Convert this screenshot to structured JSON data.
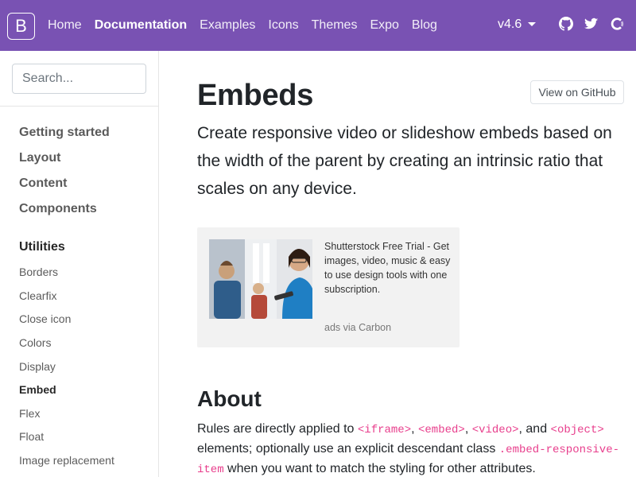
{
  "colors": {
    "navbar": "#7952b3",
    "code": "#e83e8c"
  },
  "navbar": {
    "brand": "B",
    "links": [
      {
        "label": "Home"
      },
      {
        "label": "Documentation"
      },
      {
        "label": "Examples"
      },
      {
        "label": "Icons"
      },
      {
        "label": "Themes"
      },
      {
        "label": "Expo"
      },
      {
        "label": "Blog"
      }
    ],
    "version": "v4.6",
    "icons": [
      "github-icon",
      "twitter-icon",
      "opencollective-icon"
    ]
  },
  "sidebar": {
    "search_placeholder": "Search...",
    "groups": [
      "Getting started",
      "Layout",
      "Content",
      "Components",
      "Utilities"
    ],
    "utilities_items": [
      "Borders",
      "Clearfix",
      "Close icon",
      "Colors",
      "Display",
      "Embed",
      "Flex",
      "Float",
      "Image replacement"
    ]
  },
  "main": {
    "title": "Embeds",
    "github_button": "View on GitHub",
    "lead": "Create responsive video or slideshow embeds based on the width of the parent by creating an intrinsic ratio that scales on any device.",
    "ad": {
      "text": "Shutterstock Free Trial - Get images, video, music & easy to use design tools with one subscription.",
      "poweredby": "ads via Carbon"
    },
    "about": {
      "heading": "About",
      "p1": "Rules are directly applied to ",
      "c1": "<iframe>",
      "s1": ", ",
      "c2": "<embed>",
      "s2": ", ",
      "c3": "<video>",
      "s3": ", and ",
      "c4": "<object>",
      "p2": " elements; optionally use an explicit descendant class ",
      "c5": ".embed-responsive-item",
      "p3": " when you want to match the styling for other attributes."
    }
  }
}
